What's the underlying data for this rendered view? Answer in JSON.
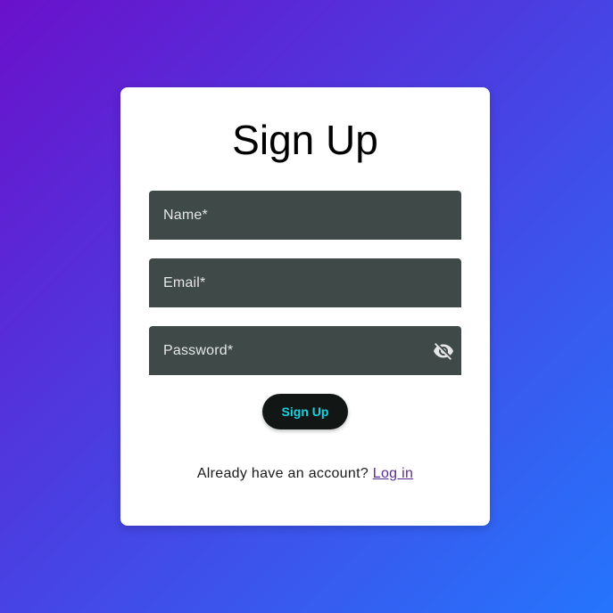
{
  "form": {
    "title": "Sign Up",
    "fields": {
      "name": {
        "placeholder": "Name*",
        "value": ""
      },
      "email": {
        "placeholder": "Email*",
        "value": ""
      },
      "password": {
        "placeholder": "Password*",
        "value": "",
        "toggle_icon": "eye-off-icon"
      }
    },
    "submit_label": "Sign Up",
    "footer_text": "Already have an account?",
    "login_link": "Log in"
  },
  "colors": {
    "background_gradient_start": "#6a11cb",
    "background_gradient_end": "#2575fc",
    "field_background": "#3f4a48",
    "button_background": "#121716",
    "button_text": "#18d2e0",
    "link": "#5a2d91"
  }
}
